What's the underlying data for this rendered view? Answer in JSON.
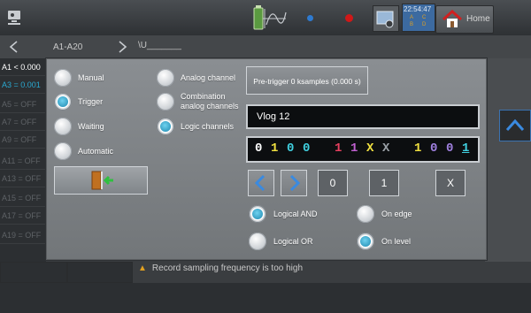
{
  "topbar": {
    "clock": {
      "time": "22:54:47",
      "cells": [
        "A",
        "C",
        "B",
        "D"
      ]
    },
    "home_label": "Home"
  },
  "bar2": {
    "group": "A1-A20",
    "unit": "\\U_______"
  },
  "channels": [
    "A1 < 0.000",
    "A3 = 0.001",
    "A5 = OFF",
    "A7 = OFF",
    "A9 = OFF",
    "A11 = OFF",
    "A13 = OFF",
    "A15 = OFF",
    "A17 = OFF",
    "A19 = OFF"
  ],
  "status": {
    "warning": "Record sampling frequency is too high"
  },
  "colors": {
    "accent": "#2aa8d0",
    "bit_blue": "#4f8fe0",
    "bit_red": "#e84060",
    "bit_magenta": "#c060d0",
    "bit_yellow": "#f0e040",
    "bit_gray": "#9aa0a6",
    "bit_lilac": "#a080e0",
    "bit_cyan": "#40d0e0"
  },
  "modal": {
    "modes": [
      {
        "label": "Manual",
        "selected": false
      },
      {
        "label": "Trigger",
        "selected": true
      },
      {
        "label": "Waiting",
        "selected": false
      },
      {
        "label": "Automatic",
        "selected": false
      }
    ],
    "sources": [
      {
        "label": "Analog channel",
        "selected": false
      },
      {
        "label": "Combination analog channels",
        "selected": false
      },
      {
        "label": "Logic channels",
        "selected": true
      }
    ],
    "exit_icon": "exit-door-icon",
    "pretrigger": "Pre-trigger 0 ksamples (0.000 s)",
    "vlog": "Vlog 12",
    "pattern": [
      {
        "char": "0",
        "color": "#ffffff"
      },
      {
        "char": "1",
        "color": "#f0e040"
      },
      {
        "char": "0",
        "color": "#40d0e0"
      },
      {
        "char": "0",
        "color": "#40d0e0"
      },
      {
        "char": "1",
        "color": "#e84060"
      },
      {
        "char": "1",
        "color": "#c060d0"
      },
      {
        "char": "X",
        "color": "#f0e040"
      },
      {
        "char": "X",
        "color": "#9aa0a6"
      },
      {
        "char": "1",
        "color": "#f0e040"
      },
      {
        "char": "0",
        "color": "#a080e0"
      },
      {
        "char": "0",
        "color": "#a080e0"
      },
      {
        "char": "1",
        "color": "#40d0e0"
      }
    ],
    "value_buttons": [
      "0",
      "1",
      "X"
    ],
    "logic": [
      {
        "label": "Logical AND",
        "selected": true
      },
      {
        "label": "Logical OR",
        "selected": false
      }
    ],
    "edge": [
      {
        "label": "On edge",
        "selected": false
      },
      {
        "label": "On level",
        "selected": true
      }
    ]
  }
}
